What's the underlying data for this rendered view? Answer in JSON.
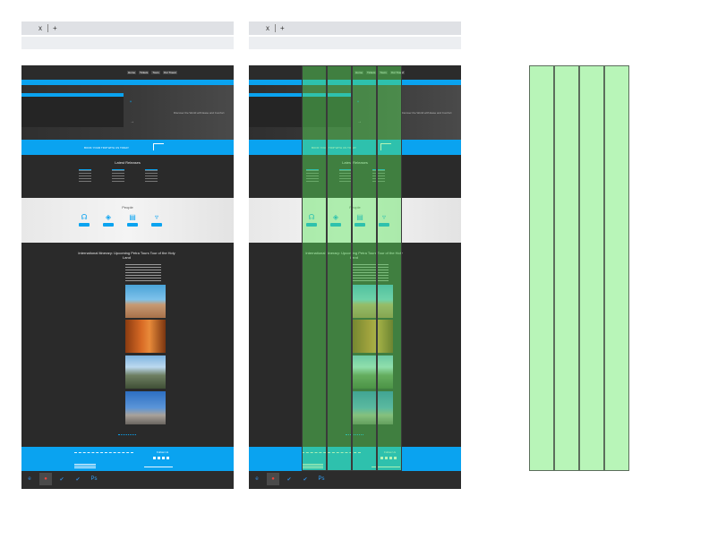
{
  "browser": {
    "close_glyph": "x",
    "new_tab_glyph": "+"
  },
  "site": {
    "nav_buttons": [
      "Home",
      "Tickets",
      "Tours",
      "Our Travel"
    ],
    "hero_title": "Discover the World with Ease and Comfort",
    "cta_text": "BOOK YOUR TRIP WITH US TODAY",
    "latest_title": "Latest Releases",
    "features_title": "People",
    "features": [
      {
        "icon": "headphones-icon",
        "glyph": "☊"
      },
      {
        "icon": "shield-icon",
        "glyph": "◈"
      },
      {
        "icon": "document-icon",
        "glyph": "▤"
      },
      {
        "icon": "microphone-icon",
        "glyph": "▿"
      }
    ],
    "tour_title": "International Itinerary: Upcoming Petra Tours Tour of the Holy Land",
    "footer_social_label": "Follow Us"
  },
  "taskbar": {
    "items": [
      {
        "name": "edge-icon",
        "glyph": "e",
        "color": "#2f86d6"
      },
      {
        "name": "chrome-icon",
        "glyph": "●",
        "color": "#e8453c"
      },
      {
        "name": "vscode-icon-1",
        "glyph": "✔",
        "color": "#2f86d6"
      },
      {
        "name": "vscode-icon-2",
        "glyph": "✔",
        "color": "#2f86d6"
      },
      {
        "name": "photoshop-icon",
        "glyph": "Ps",
        "color": "#2fa3ff"
      }
    ]
  },
  "colors": {
    "accent": "#0aa3f0",
    "overlay": "#5ae65a",
    "grid": "#b8f5b8"
  }
}
